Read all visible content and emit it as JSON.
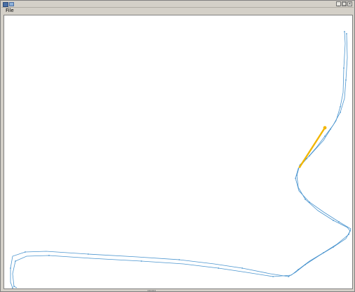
{
  "window": {
    "controls": [
      "minimize-icon",
      "maximize-icon",
      "close-icon"
    ]
  },
  "menu": {
    "file_label": "File"
  },
  "colors": {
    "track": "#4b95cf",
    "highlight": "#f2b600",
    "canvas_bg": "#ffffff"
  }
}
